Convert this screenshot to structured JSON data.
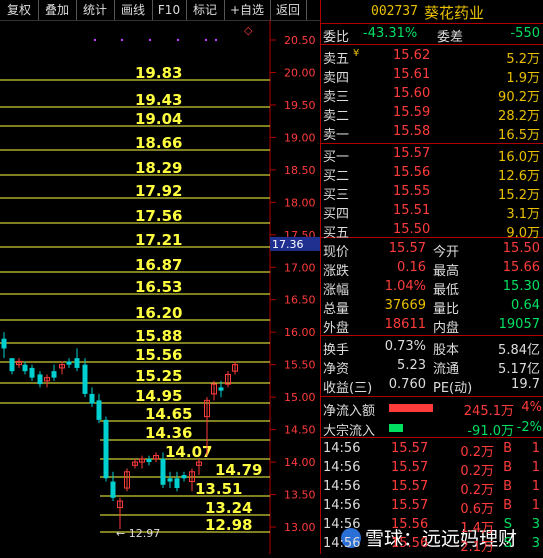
{
  "toolbar": {
    "items": [
      "复权",
      "叠加",
      "统计",
      "画线",
      "F10",
      "标记",
      "+自选",
      "返回"
    ],
    "close_label": "◇"
  },
  "chart": {
    "price_axis": [
      "20.50",
      "20.00",
      "19.50",
      "19.00",
      "18.50",
      "18.00",
      "17.50",
      "17.00",
      "16.50",
      "16.00",
      "15.50",
      "15.00",
      "14.50",
      "14.00",
      "13.50",
      "13.00"
    ],
    "current_price_marker": "17.36",
    "level_lines": [
      "19.83",
      "19.43",
      "19.04",
      "18.66",
      "18.29",
      "17.92",
      "17.56",
      "17.21",
      "16.87",
      "16.53",
      "16.20",
      "15.88",
      "15.56",
      "15.25",
      "14.95",
      "14.65",
      "14.36",
      "14.07",
      "14.79",
      "13.51",
      "13.24",
      "12.98"
    ],
    "low_annotation": "12.97",
    "colors": {
      "up": "#ff3c3c",
      "down": "#00d0d0",
      "level": "#ffff40",
      "grid": "#b00000"
    }
  },
  "quote": {
    "code": "002737",
    "name": "葵花药业",
    "weibi_label": "委比",
    "weibi_value": "-43.31%",
    "weicha_label": "委差",
    "weicha_value": "-550",
    "asks": [
      {
        "label": "卖五",
        "flag": "¥",
        "price": "15.62",
        "vol": "5.2万"
      },
      {
        "label": "卖四",
        "flag": "",
        "price": "15.61",
        "vol": "1.9万"
      },
      {
        "label": "卖三",
        "flag": "",
        "price": "15.60",
        "vol": "90.2万"
      },
      {
        "label": "卖二",
        "flag": "",
        "price": "15.59",
        "vol": "28.2万"
      },
      {
        "label": "卖一",
        "flag": "",
        "price": "15.58",
        "vol": "16.5万"
      }
    ],
    "bids": [
      {
        "label": "买一",
        "price": "15.57",
        "vol": "16.0万"
      },
      {
        "label": "买二",
        "price": "15.56",
        "vol": "12.6万"
      },
      {
        "label": "买三",
        "price": "15.55",
        "vol": "15.2万"
      },
      {
        "label": "买四",
        "price": "15.51",
        "vol": "3.1万"
      },
      {
        "label": "买五",
        "price": "15.50",
        "vol": "9.0万"
      }
    ],
    "stats": [
      {
        "l1": "现价",
        "v1": "15.57",
        "c1": "red",
        "l2": "今开",
        "v2": "15.50",
        "c2": "red"
      },
      {
        "l1": "涨跌",
        "v1": "0.16",
        "c1": "red",
        "l2": "最高",
        "v2": "15.66",
        "c2": "red"
      },
      {
        "l1": "涨幅",
        "v1": "1.04%",
        "c1": "red",
        "l2": "最低",
        "v2": "15.30",
        "c2": "grn"
      },
      {
        "l1": "总量",
        "v1": "37669",
        "c1": "yel",
        "l2": "量比",
        "v2": "0.64",
        "c2": "grn"
      },
      {
        "l1": "外盘",
        "v1": "18611",
        "c1": "red",
        "l2": "内盘",
        "v2": "19057",
        "c2": "grn"
      }
    ],
    "stats2": [
      {
        "l1": "换手",
        "v1": "0.73%",
        "l2": "股本",
        "v2": "5.84亿"
      },
      {
        "l1": "净资",
        "v1": "5.23",
        "l2": "流通",
        "v2": "5.17亿"
      },
      {
        "l1": "收益(三)",
        "v1": "0.760",
        "l2": "PE(动)",
        "v2": "19.7"
      }
    ],
    "flows": [
      {
        "label": "净流入额",
        "value": "245.1万",
        "pct": "4%",
        "color": "red"
      },
      {
        "label": "大宗流入",
        "value": "-91.0万",
        "pct": "-2%",
        "color": "grn"
      }
    ],
    "ticks": [
      {
        "time": "14:56",
        "price": "15.57",
        "vol": "0.2万",
        "bs": "B"
      },
      {
        "time": "14:56",
        "price": "15.57",
        "vol": "0.2万",
        "bs": "B"
      },
      {
        "time": "14:56",
        "price": "15.57",
        "vol": "0.2万",
        "bs": "B"
      },
      {
        "time": "14:56",
        "price": "15.57",
        "vol": "0.6万",
        "bs": "B"
      },
      {
        "time": "14:56",
        "price": "15.56",
        "vol": "1.4万",
        "bs": "S"
      },
      {
        "time": "14:56",
        "price": "15.56",
        "vol": "2.1万",
        "bs": "S"
      }
    ],
    "tick_counts": [
      "1",
      "1",
      "1",
      "1",
      "3",
      "3"
    ]
  },
  "watermark": "雪球：远远妈理财"
}
